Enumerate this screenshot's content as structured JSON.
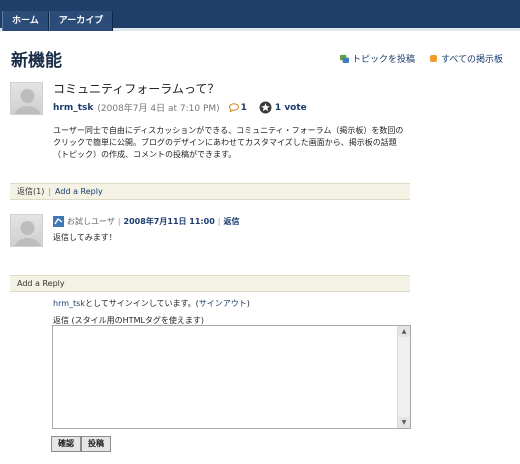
{
  "nav": {
    "tabs": [
      "ホーム",
      "アーカイブ"
    ]
  },
  "page": {
    "title": "新機能",
    "post_topic_label": "トピックを投稿",
    "all_boards_label": "すべての掲示板"
  },
  "topic": {
    "title": "コミュニティフォーラムって？",
    "author": "hrm_tsk",
    "date": "(2008年7月 4日 at 7:10 PM)",
    "comment_count": "1",
    "votes": "1 vote",
    "body": "ユーザー同士で自由にディスカッションができる、コミュニティ・フォーラム（掲示板）を数回のクリックで簡単に公開。ブログのデザインにあわせてカスタマイズした画面から、掲示板の話題（トピック）の作成、コメントの投稿ができます。"
  },
  "replies_bar": {
    "count_label": "返信(1)",
    "add_reply": "Add a Reply"
  },
  "reply": {
    "author": "お試しユーザ",
    "date": "2008年7月11日 11:00",
    "reply_link": "返信",
    "text": "返信してみます！"
  },
  "form": {
    "header": "Add a Reply",
    "user": "hrm_tsk",
    "signed_in_mid": "としてサインインしています。(",
    "sign_out": "サインアウト",
    "signed_in_end": ")",
    "textarea_label": "返信 (スタイル用のHTMLタグを使えます)",
    "textarea_value": "",
    "confirm_button": "確認",
    "submit_button": "投稿"
  },
  "colors": {
    "nav_bg": "#1f3f68",
    "link": "#1a3c6d",
    "bar_bg": "#f4f2e4"
  },
  "icons": [
    "post-topic-icon",
    "rss-icon",
    "comment-icon",
    "star-icon",
    "guest-user-icon"
  ]
}
